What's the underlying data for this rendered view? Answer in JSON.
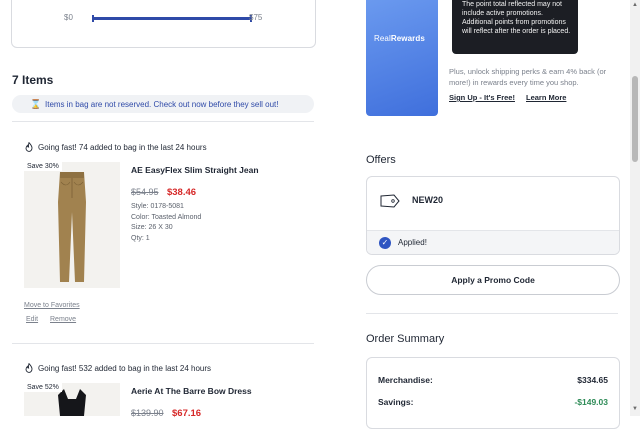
{
  "shipping_progress": {
    "min_label": "$0",
    "max_label": "$75",
    "progress_fraction": 1.0
  },
  "bag": {
    "items_heading": "7 Items",
    "notice": "Items in bag are not reserved. Check out now before they sell out!",
    "products": [
      {
        "going_fast": "Going fast! 74 added to bag in the last 24 hours",
        "save_badge": "Save 30%",
        "name": "AE EasyFlex Slim Straight Jean",
        "original_price": "$54.95",
        "sale_price": "$38.46",
        "style": "Style: 0178-5081",
        "color": "Color: Toasted Almond",
        "size": "Size: 26 X 30",
        "qty": "Qty: 1",
        "move_to_favorites": "Move to Favorites",
        "edit": "Edit",
        "remove": "Remove"
      },
      {
        "going_fast": "Going fast! 532 added to bag in the last 24 hours",
        "save_badge": "Save 52%",
        "name": "Aerie At The Barre Bow Dress",
        "original_price": "$139.90",
        "sale_price": "$67.16"
      }
    ]
  },
  "rewards": {
    "logo_prefix": "Real",
    "logo_suffix": "Rewards",
    "tooltip": "The point total reflected may not include active promotions. Additional points from promotions will reflect after the order is placed.",
    "description": "Plus, unlock shipping perks & earn 4% back (or more!) in rewards every time you shop.",
    "signup_link": "Sign Up - It's Free!",
    "learn_more_link": "Learn More"
  },
  "offers": {
    "title": "Offers",
    "code": "NEW20",
    "applied_label": "Applied!",
    "promo_button": "Apply a Promo Code"
  },
  "order_summary": {
    "title": "Order Summary",
    "rows": [
      {
        "label": "Merchandise:",
        "value": "$334.65"
      },
      {
        "label": "Savings:",
        "value": "-$149.03"
      }
    ]
  },
  "colors": {
    "accent_blue": "#2f4aa8",
    "sale_red": "#d62828",
    "savings_green": "#2e8b57",
    "rewards_gradient_start": "#6d9cf0",
    "rewards_gradient_end": "#3f6fdc"
  },
  "icons": {
    "notice_icon": "hourglass-icon",
    "going_fast_icon": "flame-icon",
    "offer_icon": "tag-icon",
    "applied_icon": "check-circle-icon"
  }
}
